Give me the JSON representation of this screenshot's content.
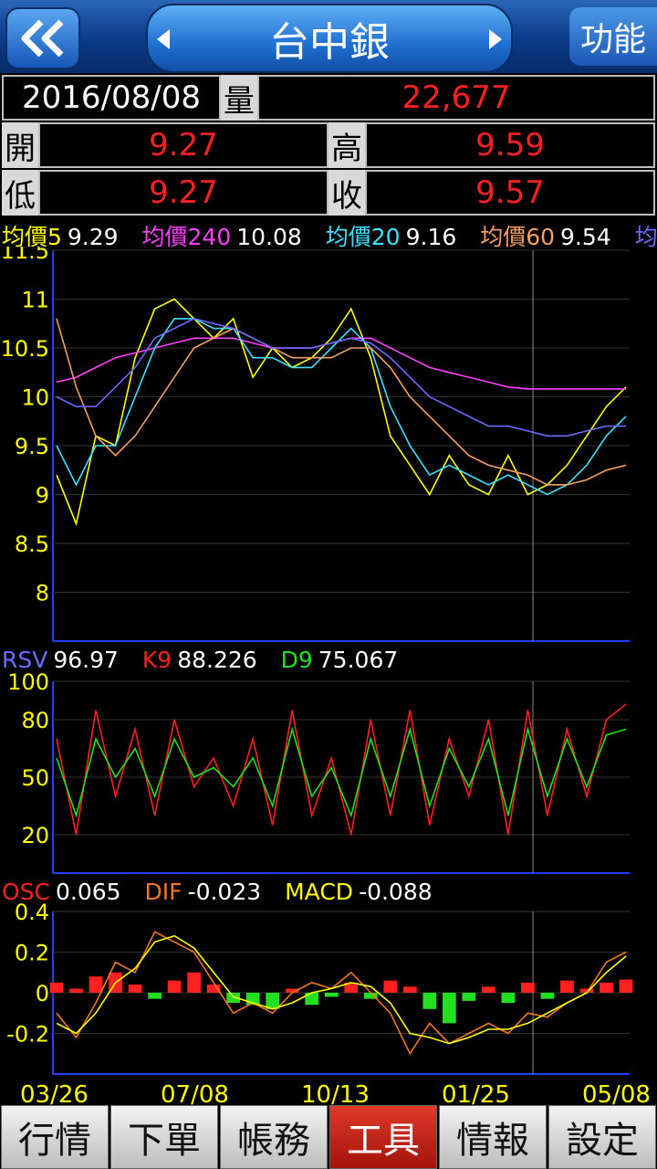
{
  "header": {
    "title": "台中銀",
    "func_label": "功能"
  },
  "info": {
    "date": "2016/08/08",
    "volume_label": "量",
    "volume": "22,677",
    "open_label": "開",
    "open": "9.27",
    "high_label": "高",
    "high": "9.59",
    "low_label": "低",
    "low": "9.27",
    "close_label": "收",
    "close": "9.57"
  },
  "ma": [
    {
      "label": "均價5",
      "value": "9.29",
      "color": "#ffff00"
    },
    {
      "label": "均價240",
      "value": "10.08",
      "color": "#ff40ff"
    },
    {
      "label": "均價20",
      "value": "9.16",
      "color": "#40e0ff"
    },
    {
      "label": "均價60",
      "value": "9.54",
      "color": "#f4a060"
    },
    {
      "label": "均",
      "value": "",
      "color": "#6b6bff"
    }
  ],
  "kd": {
    "rsv_label": "RSV",
    "rsv": "96.97",
    "k_label": "K9",
    "k": "88.226",
    "d_label": "D9",
    "d": "75.067"
  },
  "macd": {
    "osc_label": "OSC",
    "osc": "0.065",
    "dif_label": "DIF",
    "dif": "-0.023",
    "macd_label": "MACD",
    "macd": "-0.088"
  },
  "chart_data": [
    {
      "type": "line",
      "name": "price",
      "y_ticks": [
        "11.5",
        "11",
        "10.5",
        "10",
        "9.5",
        "9",
        "8.5",
        "8"
      ],
      "ylim": [
        7.5,
        11.5
      ],
      "x_labels": [
        "03/26",
        "07/08",
        "10/13",
        "01/25",
        "05/08"
      ],
      "series": [
        {
          "name": "均價5",
          "values": [
            9.2,
            8.7,
            9.6,
            9.5,
            10.4,
            10.9,
            11.0,
            10.8,
            10.6,
            10.8,
            10.2,
            10.5,
            10.3,
            10.4,
            10.6,
            10.9,
            10.4,
            9.6,
            9.3,
            9.0,
            9.4,
            9.1,
            9.0,
            9.4,
            9.0,
            9.1,
            9.3,
            9.6,
            9.9,
            10.1
          ]
        },
        {
          "name": "均價240",
          "values": [
            10.15,
            10.2,
            10.3,
            10.4,
            10.45,
            10.5,
            10.55,
            10.6,
            10.6,
            10.6,
            10.55,
            10.5,
            10.5,
            10.5,
            10.55,
            10.6,
            10.6,
            10.5,
            10.4,
            10.3,
            10.25,
            10.2,
            10.15,
            10.1,
            10.08,
            10.08,
            10.08,
            10.08,
            10.08,
            10.08
          ]
        },
        {
          "name": "均價20",
          "values": [
            9.5,
            9.1,
            9.5,
            9.5,
            10.0,
            10.5,
            10.8,
            10.8,
            10.7,
            10.7,
            10.4,
            10.4,
            10.3,
            10.3,
            10.5,
            10.7,
            10.5,
            9.9,
            9.5,
            9.2,
            9.3,
            9.2,
            9.1,
            9.2,
            9.1,
            9.0,
            9.1,
            9.3,
            9.6,
            9.8
          ]
        },
        {
          "name": "均價60",
          "values": [
            10.8,
            10.1,
            9.6,
            9.4,
            9.6,
            9.9,
            10.2,
            10.5,
            10.6,
            10.7,
            10.6,
            10.5,
            10.4,
            10.4,
            10.4,
            10.5,
            10.5,
            10.3,
            10.0,
            9.8,
            9.6,
            9.4,
            9.3,
            9.25,
            9.2,
            9.1,
            9.1,
            9.15,
            9.25,
            9.3
          ]
        },
        {
          "name": "均",
          "values": [
            10.0,
            9.9,
            9.9,
            10.1,
            10.3,
            10.6,
            10.7,
            10.8,
            10.75,
            10.7,
            10.6,
            10.5,
            10.5,
            10.5,
            10.55,
            10.6,
            10.55,
            10.4,
            10.2,
            10.0,
            9.9,
            9.8,
            9.7,
            9.7,
            9.65,
            9.6,
            9.6,
            9.65,
            9.7,
            9.7
          ]
        }
      ]
    },
    {
      "type": "line",
      "name": "kd",
      "y_ticks": [
        "100",
        "80",
        "50",
        "20"
      ],
      "ylim": [
        0,
        100
      ],
      "series": [
        {
          "name": "K9",
          "values": [
            70,
            20,
            85,
            40,
            75,
            30,
            80,
            45,
            60,
            35,
            70,
            25,
            85,
            30,
            60,
            20,
            80,
            30,
            85,
            25,
            70,
            40,
            80,
            20,
            85,
            30,
            75,
            40,
            80,
            88
          ]
        },
        {
          "name": "D9",
          "values": [
            60,
            30,
            70,
            50,
            65,
            40,
            70,
            50,
            55,
            45,
            60,
            35,
            75,
            40,
            55,
            30,
            70,
            40,
            75,
            35,
            65,
            45,
            70,
            30,
            75,
            40,
            70,
            45,
            72,
            75
          ]
        }
      ]
    },
    {
      "type": "bar",
      "name": "macd",
      "y_ticks": [
        "0.4",
        "0.2",
        "0",
        "-0.2"
      ],
      "ylim": [
        -0.4,
        0.4
      ],
      "series": [
        {
          "name": "OSC",
          "values": [
            0.05,
            0.02,
            0.08,
            0.1,
            0.04,
            -0.03,
            0.06,
            0.1,
            0.04,
            -0.05,
            -0.06,
            -0.08,
            0.02,
            -0.06,
            -0.02,
            0.05,
            -0.03,
            0.06,
            0.03,
            -0.08,
            -0.15,
            -0.04,
            0.03,
            -0.05,
            0.05,
            -0.03,
            0.06,
            0.02,
            0.05,
            0.065
          ]
        },
        {
          "name": "DIF",
          "values": [
            -0.1,
            -0.22,
            -0.05,
            0.15,
            0.1,
            0.3,
            0.25,
            0.2,
            0.05,
            -0.1,
            -0.05,
            -0.1,
            0.0,
            0.05,
            0.02,
            0.1,
            0.0,
            -0.1,
            -0.3,
            -0.15,
            -0.25,
            -0.2,
            -0.15,
            -0.2,
            -0.1,
            -0.12,
            -0.05,
            0.0,
            0.15,
            0.2
          ]
        },
        {
          "name": "MACD",
          "values": [
            -0.15,
            -0.2,
            -0.1,
            0.05,
            0.12,
            0.25,
            0.28,
            0.22,
            0.1,
            -0.02,
            -0.05,
            -0.08,
            -0.05,
            0.0,
            0.02,
            0.05,
            0.03,
            -0.05,
            -0.2,
            -0.22,
            -0.25,
            -0.22,
            -0.18,
            -0.18,
            -0.15,
            -0.1,
            -0.05,
            0.0,
            0.1,
            0.18
          ]
        }
      ]
    }
  ],
  "nav": {
    "items": [
      "行情",
      "下單",
      "帳務",
      "工具",
      "情報",
      "設定"
    ],
    "active": 3
  }
}
